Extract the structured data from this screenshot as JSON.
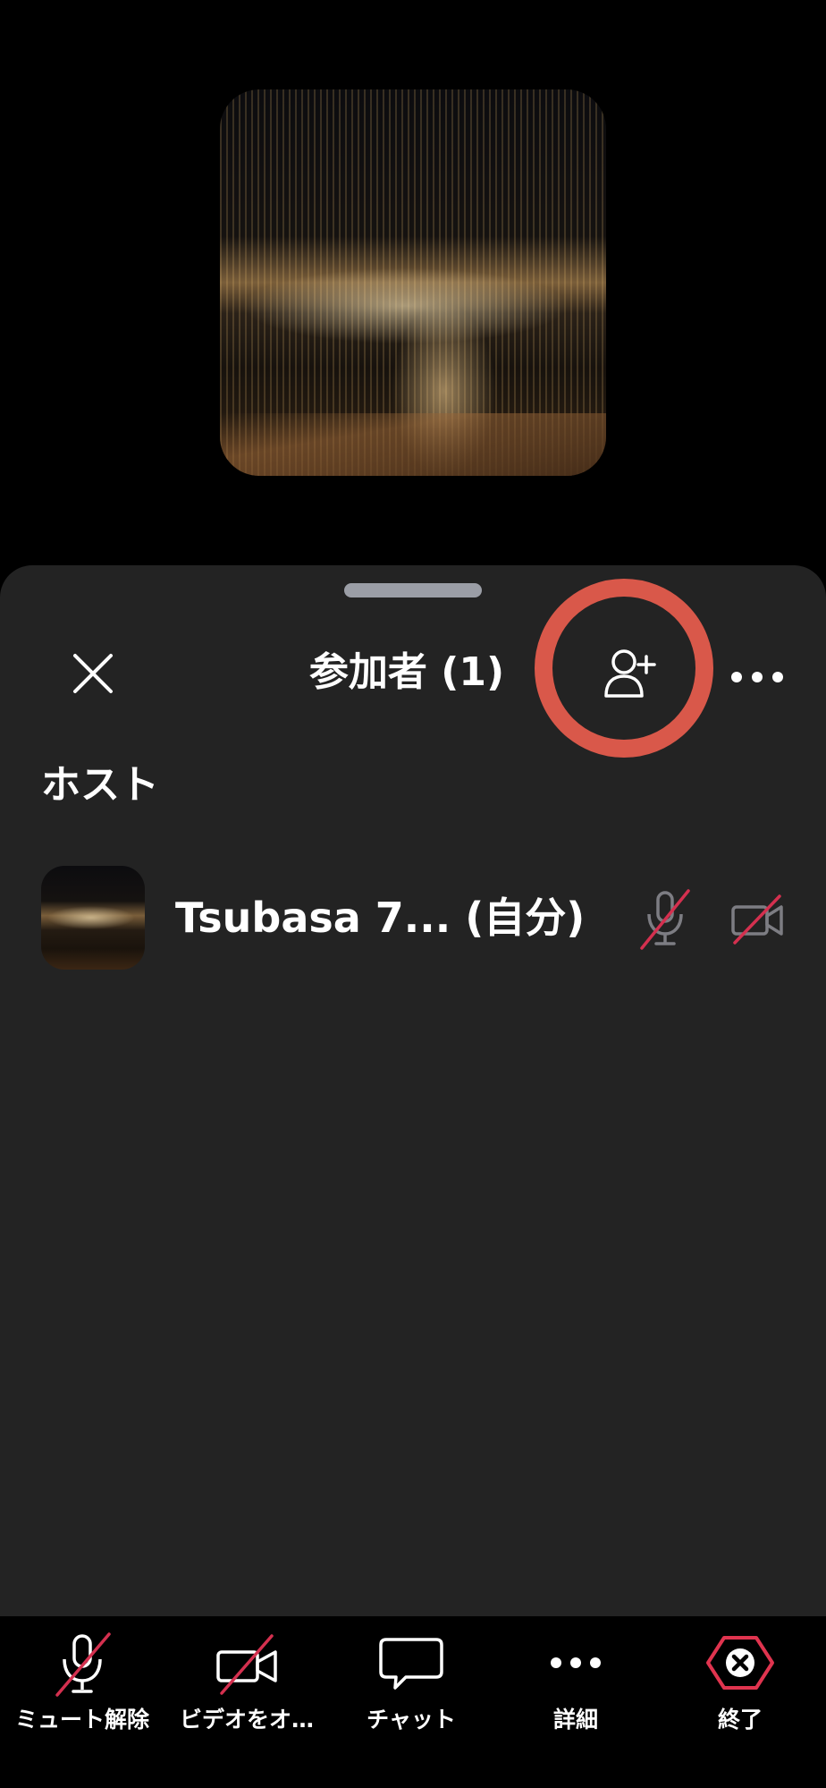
{
  "meeting": {
    "video_thumbnail": "city-night-view-image"
  },
  "sheet": {
    "title": "参加者 (1)",
    "close_icon": "close-icon",
    "add_participant_icon": "add-person-icon",
    "more_icon": "more-dots-icon",
    "section_label": "ホスト",
    "participants": [
      {
        "name": "Tsubasa 7... (自分)",
        "mic_icon": "mic-muted-icon",
        "camera_icon": "camera-off-icon"
      }
    ]
  },
  "toolbar": {
    "items": [
      {
        "label": "ミュート解除",
        "icon": "mic-muted-icon"
      },
      {
        "label": "ビデオをオ…",
        "icon": "camera-off-icon"
      },
      {
        "label": "チャット",
        "icon": "chat-bubble-icon"
      },
      {
        "label": "詳細",
        "icon": "more-dots-icon"
      },
      {
        "label": "終了",
        "icon": "end-meeting-icon"
      }
    ]
  },
  "colors": {
    "sheet_bg": "#232323",
    "highlight_ring": "#d9584a",
    "muted_slash": "#d4304f",
    "end_red": "#e0344f"
  }
}
